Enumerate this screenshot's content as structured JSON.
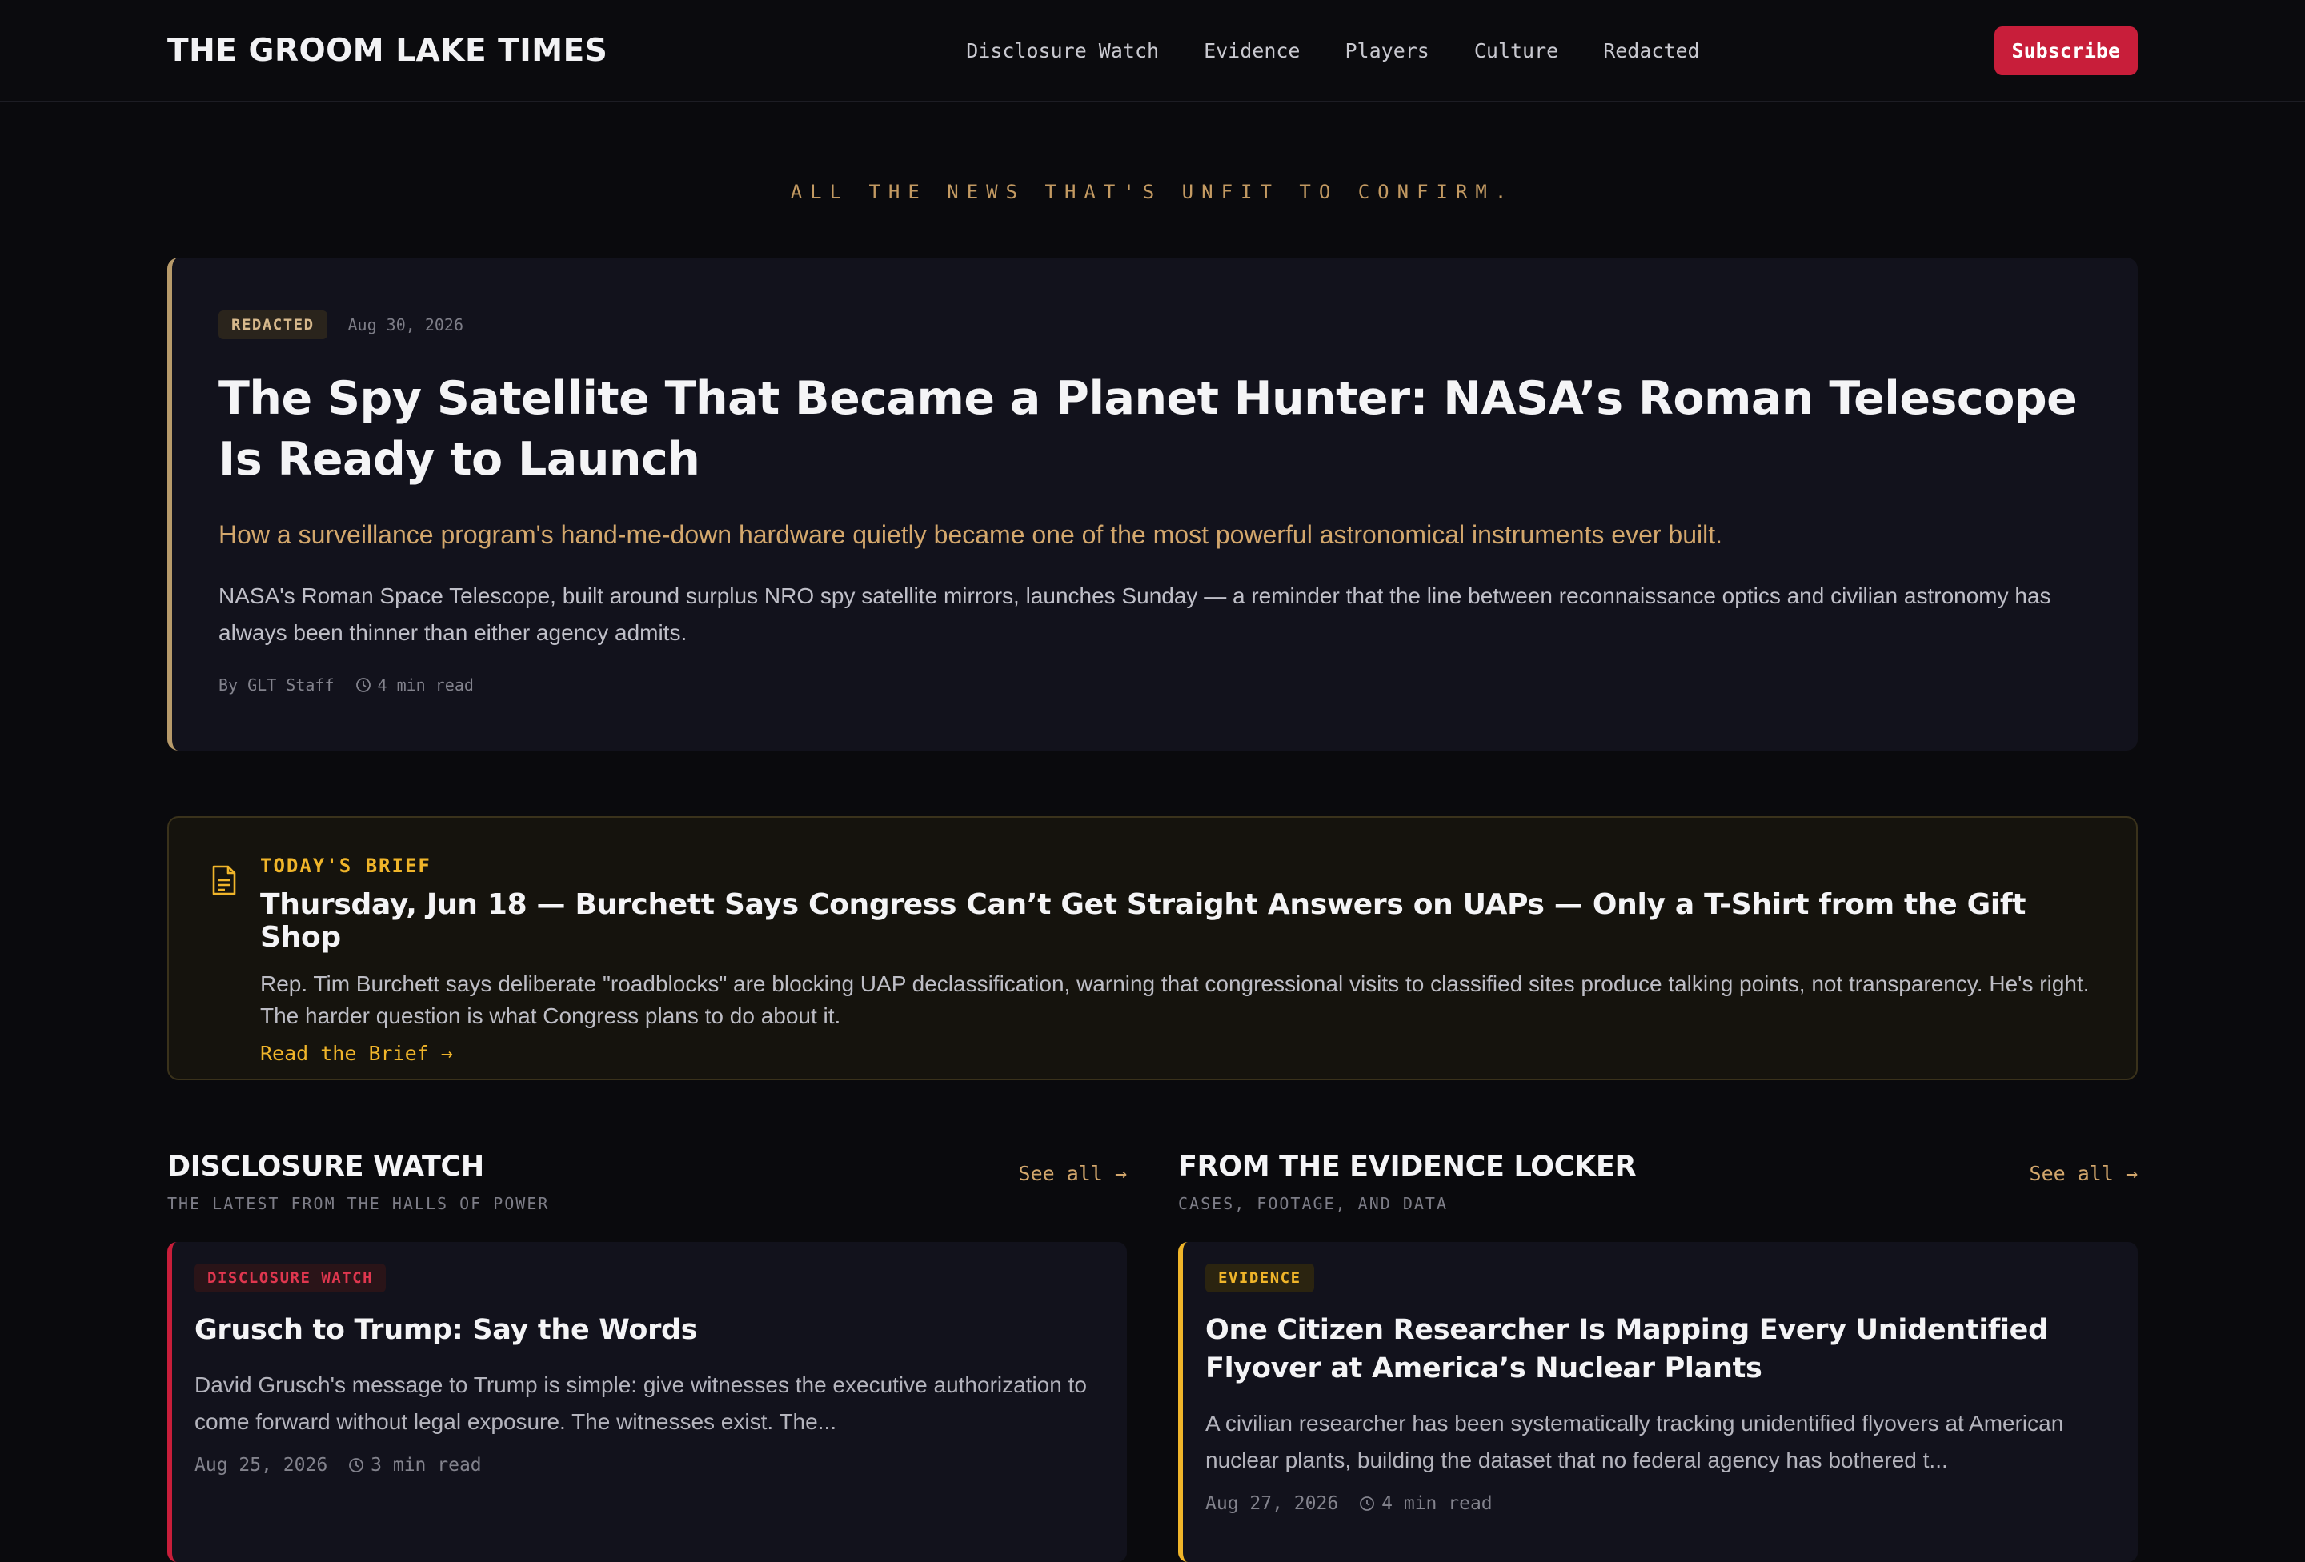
{
  "brand": "THE GROOM LAKE TIMES",
  "nav": [
    "Disclosure Watch",
    "Evidence",
    "Players",
    "Culture",
    "Redacted"
  ],
  "subscribe": "Subscribe",
  "tagline": "ALL THE NEWS THAT'S UNFIT TO CONFIRM.",
  "hero": {
    "badge": "REDACTED",
    "date": "Aug 30, 2026",
    "title": "The Spy Satellite That Became a Planet Hunter: NASA’s Roman Telescope Is Ready to Launch",
    "deck": "How a surveillance program's hand-me-down hardware quietly became one of the most powerful astronomical instruments ever built.",
    "body": "NASA's Roman Space Telescope, built around surplus NRO spy satellite mirrors, launches Sunday — a reminder that the line between reconnaissance optics and civilian astronomy has always been thinner than either agency admits.",
    "author": "By GLT Staff",
    "read": "4 min read"
  },
  "brief": {
    "label": "TODAY'S BRIEF",
    "title": "Thursday, Jun 18 — Burchett Says Congress Can’t Get Straight Answers on UAPs — Only a T-Shirt from the Gift Shop",
    "body": "Rep. Tim Burchett says deliberate \"roadblocks\" are blocking UAP declassification, warning that congressional visits to classified sites produce talking points, not transparency. He's right. The harder question is what Congress plans to do about it.",
    "cta": "Read the Brief →"
  },
  "disclosure": {
    "title": "DISCLOSURE WATCH",
    "subtitle": "THE LATEST FROM THE HALLS OF POWER",
    "see_all": "See all →",
    "card": {
      "badge": "DISCLOSURE WATCH",
      "title": "Grusch to Trump: Say the Words",
      "excerpt": "David Grusch's message to Trump is simple: give witnesses the executive authorization to come forward without legal exposure. The witnesses exist. The...",
      "date": "Aug 25, 2026",
      "read": "3 min read"
    }
  },
  "evidence": {
    "title": "FROM THE EVIDENCE LOCKER",
    "subtitle": "CASES, FOOTAGE, AND DATA",
    "see_all": "See all →",
    "card": {
      "badge": "EVIDENCE",
      "title": "One Citizen Researcher Is Mapping Every Unidentified Flyover at America’s Nuclear Plants",
      "excerpt": "A civilian researcher has been systematically tracking unidentified flyovers at American nuclear plants, building the dataset that no federal agency has bothered t...",
      "date": "Aug 27, 2026",
      "read": "4 min read"
    }
  },
  "colors": {
    "accent_red": "#c81e3a",
    "accent_gold": "#f0b52a",
    "tan": "#d3a76c",
    "bg": "#0a0a0d"
  }
}
